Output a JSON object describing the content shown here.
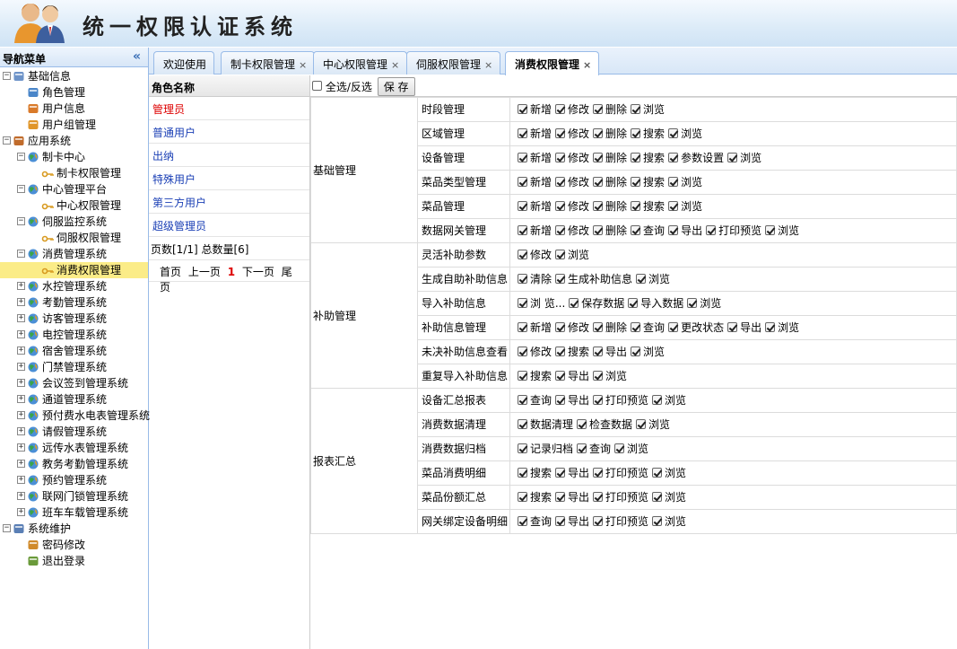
{
  "app": {
    "title": "统一权限认证系统"
  },
  "nav": {
    "title": "导航菜单",
    "items": [
      {
        "label": "基础信息",
        "icon": "folder-info-icon",
        "level": 0,
        "toggle": "-"
      },
      {
        "label": "角色管理",
        "icon": "role-card-icon",
        "level": 1
      },
      {
        "label": "用户信息",
        "icon": "user-icon",
        "level": 1
      },
      {
        "label": "用户组管理",
        "icon": "user-group-icon",
        "level": 1
      },
      {
        "label": "应用系统",
        "icon": "home-icon",
        "level": 0,
        "toggle": "-"
      },
      {
        "label": "制卡中心",
        "icon": "globe-icon",
        "level": 1,
        "toggle": "-"
      },
      {
        "label": "制卡权限管理",
        "icon": "key-icon",
        "level": 2
      },
      {
        "label": "中心管理平台",
        "icon": "globe-icon",
        "level": 1,
        "toggle": "-"
      },
      {
        "label": "中心权限管理",
        "icon": "key-icon",
        "level": 2
      },
      {
        "label": "伺服监控系统",
        "icon": "globe-icon",
        "level": 1,
        "toggle": "-"
      },
      {
        "label": "伺服权限管理",
        "icon": "key-icon",
        "level": 2
      },
      {
        "label": "消费管理系统",
        "icon": "globe-icon",
        "level": 1,
        "toggle": "-"
      },
      {
        "label": "消费权限管理",
        "icon": "key-icon",
        "level": 2,
        "selected": true
      },
      {
        "label": "水控管理系统",
        "icon": "globe-icon",
        "level": 1,
        "toggle": "+"
      },
      {
        "label": "考勤管理系统",
        "icon": "globe-icon",
        "level": 1,
        "toggle": "+"
      },
      {
        "label": "访客管理系统",
        "icon": "globe-icon",
        "level": 1,
        "toggle": "+"
      },
      {
        "label": "电控管理系统",
        "icon": "globe-icon",
        "level": 1,
        "toggle": "+"
      },
      {
        "label": "宿舍管理系统",
        "icon": "globe-icon",
        "level": 1,
        "toggle": "+"
      },
      {
        "label": "门禁管理系统",
        "icon": "globe-icon",
        "level": 1,
        "toggle": "+"
      },
      {
        "label": "会议签到管理系统",
        "icon": "globe-icon",
        "level": 1,
        "toggle": "+"
      },
      {
        "label": "通道管理系统",
        "icon": "globe-icon",
        "level": 1,
        "toggle": "+"
      },
      {
        "label": "预付费水电表管理系统",
        "icon": "globe-icon",
        "level": 1,
        "toggle": "+"
      },
      {
        "label": "请假管理系统",
        "icon": "globe-icon",
        "level": 1,
        "toggle": "+"
      },
      {
        "label": "远传水表管理系统",
        "icon": "globe-icon",
        "level": 1,
        "toggle": "+"
      },
      {
        "label": "教务考勤管理系统",
        "icon": "globe-icon",
        "level": 1,
        "toggle": "+"
      },
      {
        "label": "预约管理系统",
        "icon": "globe-icon",
        "level": 1,
        "toggle": "+"
      },
      {
        "label": "联网门锁管理系统",
        "icon": "globe-icon",
        "level": 1,
        "toggle": "+"
      },
      {
        "label": "班车车载管理系统",
        "icon": "globe-icon",
        "level": 1,
        "toggle": "+"
      },
      {
        "label": "系统维护",
        "icon": "computer-icon",
        "level": 0,
        "toggle": "-"
      },
      {
        "label": "密码修改",
        "icon": "user-key-icon",
        "level": 1
      },
      {
        "label": "退出登录",
        "icon": "exit-door-icon",
        "level": 1
      }
    ]
  },
  "tabs": [
    {
      "label": "欢迎使用",
      "closable": false
    },
    {
      "label": "制卡权限管理",
      "closable": true
    },
    {
      "label": "中心权限管理",
      "closable": true
    },
    {
      "label": "伺服权限管理",
      "closable": true
    },
    {
      "label": "消费权限管理",
      "closable": true,
      "active": true
    }
  ],
  "close_glyph": "×",
  "roles": {
    "header": "角色名称",
    "items": [
      "管理员",
      "普通用户",
      "出纳",
      "特殊用户",
      "第三方用户",
      "超级管理员"
    ],
    "pager_info": "页数[1/1]  总数量[6]",
    "first": "首页",
    "prev": "上一页",
    "current": "1",
    "next": "下一页",
    "last": "尾页"
  },
  "toolbar": {
    "select_all_label": "全选/反选",
    "save_label": "保 存"
  },
  "groups": [
    {
      "name": "基础管理",
      "rows": [
        {
          "name": "时段管理",
          "ops": [
            "新增",
            "修改",
            "删除",
            "浏览"
          ]
        },
        {
          "name": "区域管理",
          "ops": [
            "新增",
            "修改",
            "删除",
            "搜索",
            "浏览"
          ]
        },
        {
          "name": "设备管理",
          "ops": [
            "新增",
            "修改",
            "删除",
            "搜索",
            "参数设置",
            "浏览"
          ]
        },
        {
          "name": "菜品类型管理",
          "ops": [
            "新增",
            "修改",
            "删除",
            "搜索",
            "浏览"
          ]
        },
        {
          "name": "菜品管理",
          "ops": [
            "新增",
            "修改",
            "删除",
            "搜索",
            "浏览"
          ]
        },
        {
          "name": "数据网关管理",
          "ops": [
            "新增",
            "修改",
            "删除",
            "查询",
            "导出",
            "打印预览",
            "浏览"
          ]
        }
      ]
    },
    {
      "name": "补助管理",
      "rows": [
        {
          "name": "灵活补助参数",
          "ops": [
            "修改",
            "浏览"
          ]
        },
        {
          "name": "生成自助补助信息",
          "ops": [
            "清除",
            "生成补助信息",
            "浏览"
          ]
        },
        {
          "name": "导入补助信息",
          "ops": [
            "浏 览...",
            "保存数据",
            "导入数据",
            "浏览"
          ]
        },
        {
          "name": "补助信息管理",
          "ops": [
            "新增",
            "修改",
            "删除",
            "查询",
            "更改状态",
            "导出",
            "浏览"
          ]
        },
        {
          "name": "未决补助信息查看",
          "ops": [
            "修改",
            "搜索",
            "导出",
            "浏览"
          ]
        },
        {
          "name": "重复导入补助信息",
          "ops": [
            "搜索",
            "导出",
            "浏览"
          ]
        }
      ]
    },
    {
      "name": "报表汇总",
      "rows": [
        {
          "name": "设备汇总报表",
          "ops": [
            "查询",
            "导出",
            "打印预览",
            "浏览"
          ]
        },
        {
          "name": "消费数据清理",
          "ops": [
            "数据清理",
            "检查数据",
            "浏览"
          ]
        },
        {
          "name": "消费数据归档",
          "ops": [
            "记录归档",
            "查询",
            "浏览"
          ]
        },
        {
          "name": "菜品消费明细",
          "ops": [
            "搜索",
            "导出",
            "打印预览",
            "浏览"
          ]
        },
        {
          "name": "菜品份额汇总",
          "ops": [
            "搜索",
            "导出",
            "打印预览",
            "浏览"
          ]
        },
        {
          "name": "网关绑定设备明细",
          "ops": [
            "查询",
            "导出",
            "打印预览",
            "浏览"
          ]
        }
      ]
    }
  ]
}
